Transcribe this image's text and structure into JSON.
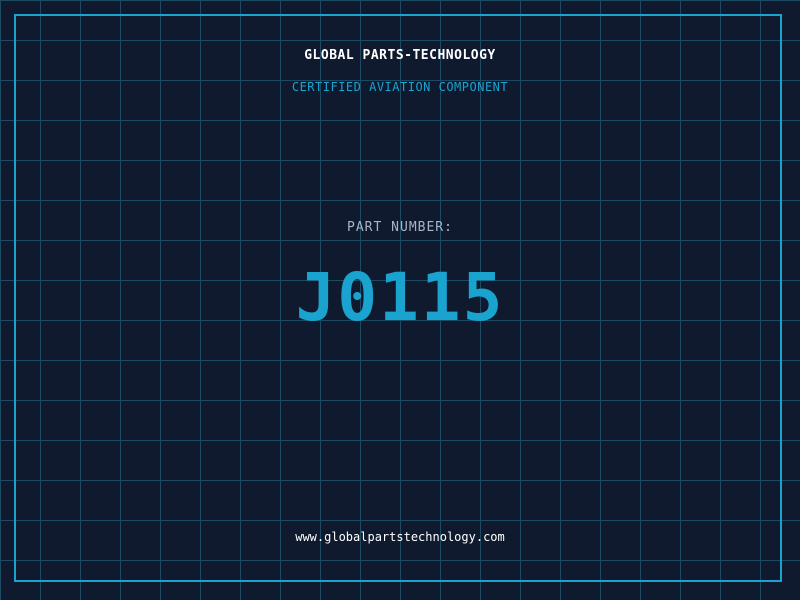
{
  "header": {
    "company": "GLOBAL PARTS-TECHNOLOGY",
    "subtitle": "CERTIFIED AVIATION COMPONENT"
  },
  "part": {
    "label": "PART NUMBER:",
    "number": "J0115"
  },
  "footer": {
    "url": "www.globalpartstechnology.com"
  },
  "colors": {
    "background": "#0f1a2e",
    "grid": "#1c4a63",
    "accent": "#1aa3cf",
    "text": "#ffffff",
    "muted": "#a9b4c4"
  }
}
